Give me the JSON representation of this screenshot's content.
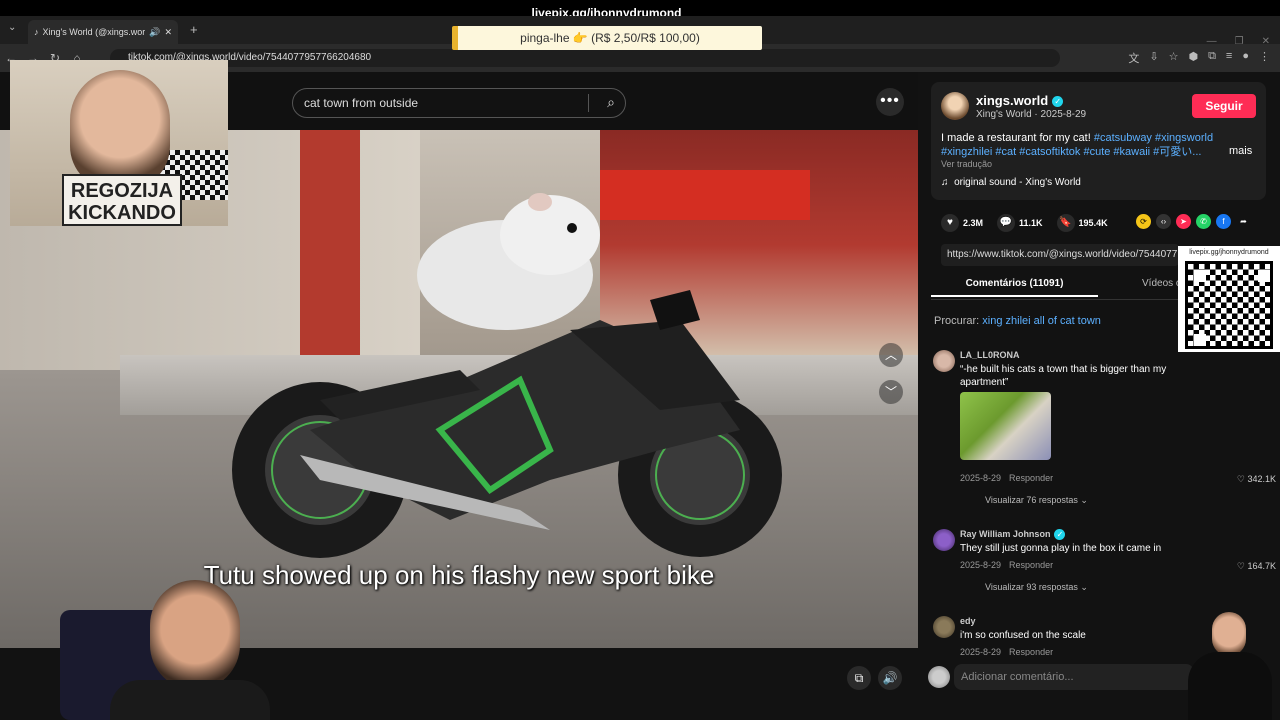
{
  "stream": {
    "url_text": "livepix.gg/jhonnydrumond",
    "donation_text": "pinga-lhe 👉 (R$ 2,50/R$ 100,00)"
  },
  "browser": {
    "tab_title": "Xing's World (@xings.world",
    "url": "tiktok.com/@xings.world/video/7544077957766204680"
  },
  "video": {
    "search_value": "cat town from outside",
    "subtitle": "Tutu showed up on his flashy new sport bike"
  },
  "author": {
    "username": "xings.world",
    "display_name": "Xing's World",
    "date": "2025-8-29",
    "follow_label": "Seguir"
  },
  "caption": {
    "text": "I made a restaurant for my cat! ",
    "hashtags_line1": "#catsubway #xingsworld",
    "hashtags_line2": "#xingzhilei #cat #catsoftiktok #cute #kawaii #可愛い...",
    "more_label": "mais",
    "translate_label": "Ver tradução",
    "music": "original sound - Xing's World"
  },
  "stats": {
    "likes": "2.3M",
    "comments": "11.1K",
    "saves": "195.4K"
  },
  "share_link": "https://www.tiktok.com/@xings.world/video/7544077",
  "tabs": {
    "comments": "Comentários (11091)",
    "videos": "Vídeos c"
  },
  "search_suggestion": {
    "prefix": "Procurar: ",
    "query": "xing zhilei all of cat town"
  },
  "comments": [
    {
      "name": "LA_LL0RONA",
      "text": "“-he built his cats a town that is bigger than my apartment”",
      "date": "2025-8-29",
      "reply_label": "Responder",
      "likes": "342.1K",
      "replies": "Visualizar 76 respostas"
    },
    {
      "name": "Ray William Johnson",
      "text": "They still just gonna play in the box it came in",
      "date": "2025-8-29",
      "reply_label": "Responder",
      "likes": "164.7K",
      "replies": "Visualizar 93 respostas"
    },
    {
      "name": "edy",
      "text": "i'm so confused on the scale",
      "date": "2025-8-29",
      "reply_label": "Responder"
    }
  ],
  "comment_input_placeholder": "Adicionar comentário...",
  "overlay": {
    "webcam_sign": "REGOZIJA KICKANDO",
    "qr_label": "livepix.gg/jhonnydrumond"
  },
  "colors": {
    "follow": "#fe2c55",
    "hashtag": "#5cb0ff",
    "verified": "#20d5ec"
  }
}
